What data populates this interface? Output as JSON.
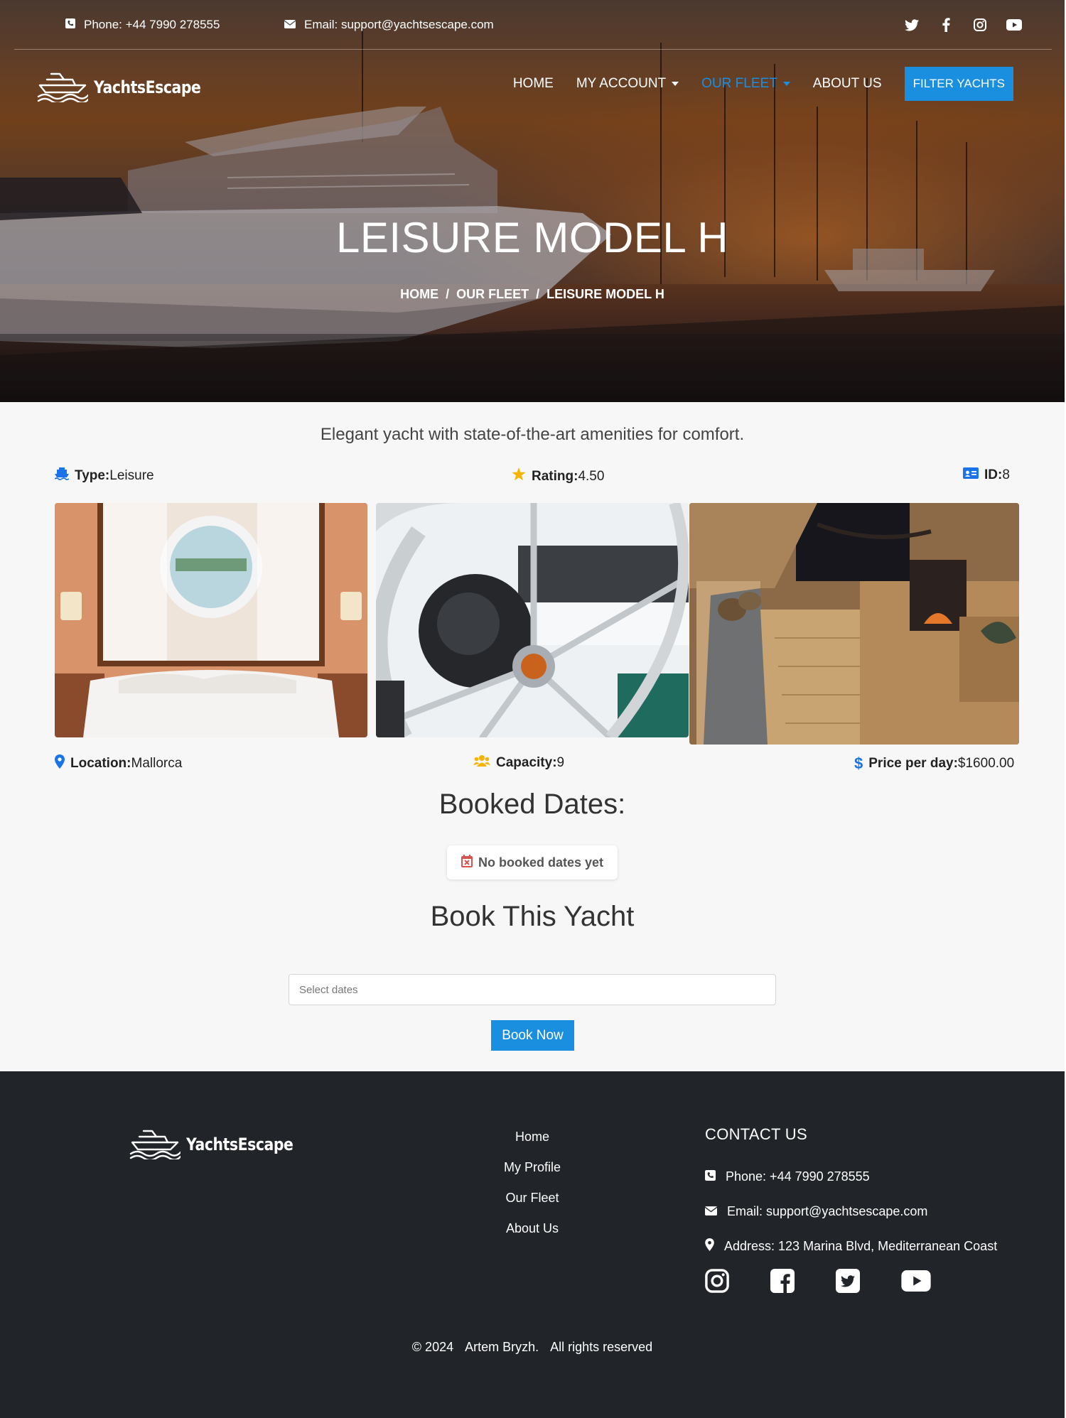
{
  "topbar": {
    "phone": "Phone: +44 7990 278555",
    "email": "Email: support@yachtsescape.com",
    "socials": [
      "twitter-icon",
      "facebook-icon",
      "instagram-icon",
      "youtube-icon"
    ]
  },
  "brand": {
    "name": "YachtsEscape"
  },
  "nav": {
    "home": "HOME",
    "account": "MY ACCOUNT",
    "fleet": "OUR FLEET",
    "about": "ABOUT US",
    "filter": "FILTER YACHTS",
    "active_color": "#1a8fe0"
  },
  "hero": {
    "title": "LEISURE MODEL H",
    "breadcrumb": [
      "HOME",
      "OUR FLEET",
      "LEISURE MODEL H"
    ],
    "breadcrumb_sep": "/"
  },
  "yacht": {
    "description": "Elegant yacht with state-of-the-art amenities for comfort.",
    "type_label": "Type:",
    "type_value": "Leisure",
    "rating_label": "Rating:",
    "rating_value": "4.50",
    "id_label": "ID:",
    "id_value": "8",
    "location_label": "Location:",
    "location_value": "Mallorca",
    "capacity_label": "Capacity:",
    "capacity_value": "9",
    "price_label": "Price per day:",
    "price_value": "$1600.00"
  },
  "booked": {
    "title": "Booked Dates:",
    "empty": "No booked dates yet"
  },
  "booking": {
    "title": "Book This Yacht",
    "placeholder": "Select dates",
    "button": "Book Now"
  },
  "footer": {
    "links": [
      "Home",
      "My Profile",
      "Our Fleet",
      "About Us"
    ],
    "contact_title": "CONTACT US",
    "phone": "Phone: +44 7990 278555",
    "email": "Email: support@yachtsescape.com",
    "address": "Address: 123 Marina Blvd, Mediterranean Coast",
    "socials": [
      "instagram-icon",
      "facebook-icon",
      "twitter-icon",
      "youtube-icon"
    ],
    "copyright": [
      "© 2024",
      "Artem Bryzh.",
      "All rights reserved"
    ]
  },
  "colors": {
    "accent": "#1a8fe0",
    "footer_bg": "#212529",
    "star": "#f5b400",
    "calendar": "#d9534f"
  }
}
